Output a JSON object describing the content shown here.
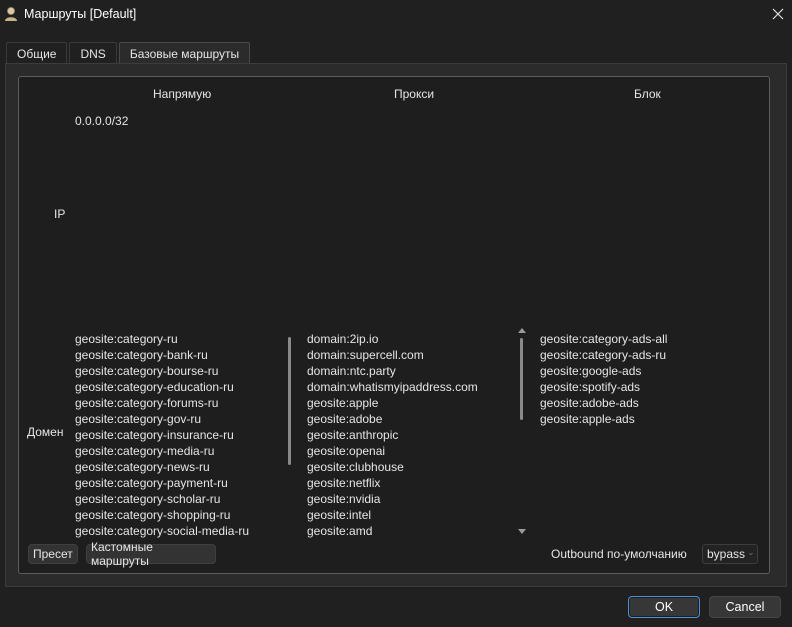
{
  "window": {
    "title": "Маршруты [Default]"
  },
  "tabs": [
    {
      "label": "Общие"
    },
    {
      "label": "DNS"
    },
    {
      "label": "Базовые маршруты"
    }
  ],
  "grid": {
    "columns": {
      "direct": "Напрямую",
      "proxy": "Прокси",
      "block": "Блок"
    },
    "rows": {
      "ip": "IP",
      "domain": "Домен"
    },
    "ip_direct": "0.0.0.0/32",
    "domain_direct": [
      "geosite:category-ru",
      "geosite:category-bank-ru",
      "geosite:category-bourse-ru",
      "geosite:category-education-ru",
      "geosite:category-forums-ru",
      "geosite:category-gov-ru",
      "geosite:category-insurance-ru",
      "geosite:category-media-ru",
      "geosite:category-news-ru",
      "geosite:category-payment-ru",
      "geosite:category-scholar-ru",
      "geosite:category-shopping-ru",
      "geosite:category-social-media-ru"
    ],
    "domain_proxy": [
      "domain:2ip.io",
      "domain:supercell.com",
      "domain:ntc.party",
      "domain:whatismyipaddress.com",
      "geosite:apple",
      "geosite:adobe",
      "geosite:anthropic",
      "geosite:openai",
      "geosite:clubhouse",
      "geosite:netflix",
      "geosite:nvidia",
      "geosite:intel",
      "geosite:amd"
    ],
    "domain_block": [
      "geosite:category-ads-all",
      "geosite:category-ads-ru",
      "geosite:google-ads",
      "geosite:spotify-ads",
      "geosite:adobe-ads",
      "geosite:apple-ads"
    ]
  },
  "footer": {
    "preset_label": "Пресет",
    "custom_routes_label": "Кастомные маршруты",
    "outbound_label": "Outbound по-умолчанию",
    "outbound_value": "bypass"
  },
  "buttons": {
    "ok": "OK",
    "cancel": "Cancel"
  }
}
